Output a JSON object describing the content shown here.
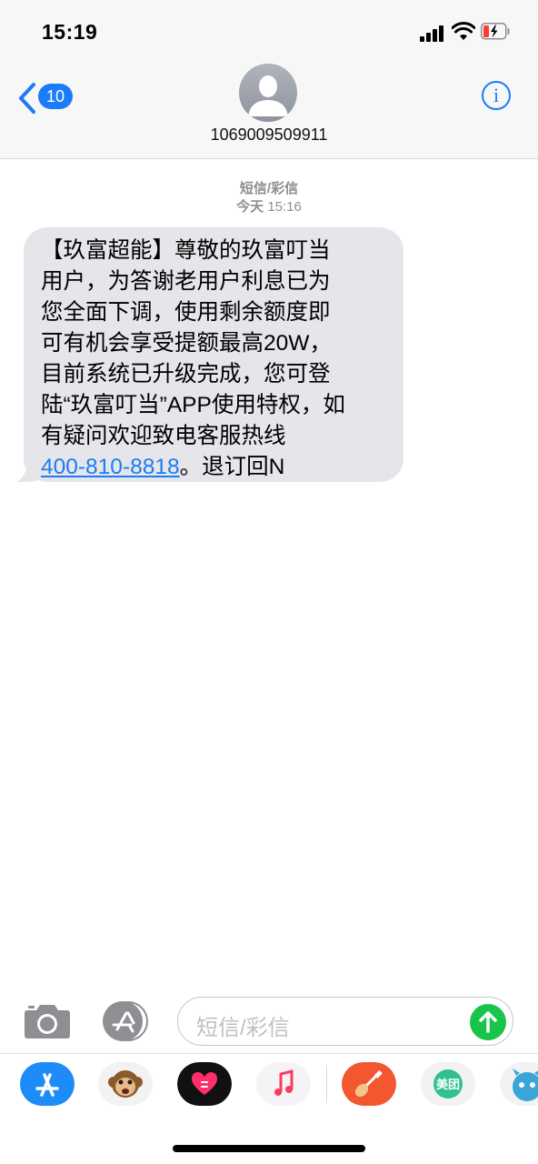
{
  "status_bar": {
    "time": "15:19",
    "icons": [
      "signal-icon",
      "wifi-icon",
      "battery-low-charging-icon"
    ]
  },
  "header": {
    "back_count": "10",
    "contact": "1069009509911",
    "info_label": "i",
    "accent_color": "#1c7cf7"
  },
  "conversation": {
    "message_type": "短信/彩信",
    "timestamp_day": "今天",
    "timestamp_time": "15:16",
    "message": {
      "lines": [
        "【玖富超能】尊敬的玖富叮当",
        "用户，为答谢老用户利息已为",
        "您全面下调，使用剩余额度即",
        "可有机会享受提额最高20W，",
        "目前系统已升级完成，您可登",
        "陆“玖富叮当”APP使用特权，如",
        "有疑问欢迎致电客服热线"
      ],
      "phone": "400-810-8818",
      "suffix": "。退订回N"
    }
  },
  "input_bar": {
    "placeholder": "短信/彩信",
    "send_color": "#19c44b"
  },
  "app_strip": {
    "apps": [
      "app-store-icon",
      "animoji-icon",
      "digital-touch-icon",
      "music-icon",
      "garageband-icon",
      "meituan-icon",
      "sticker-icon"
    ],
    "meituan_label": "美团"
  }
}
